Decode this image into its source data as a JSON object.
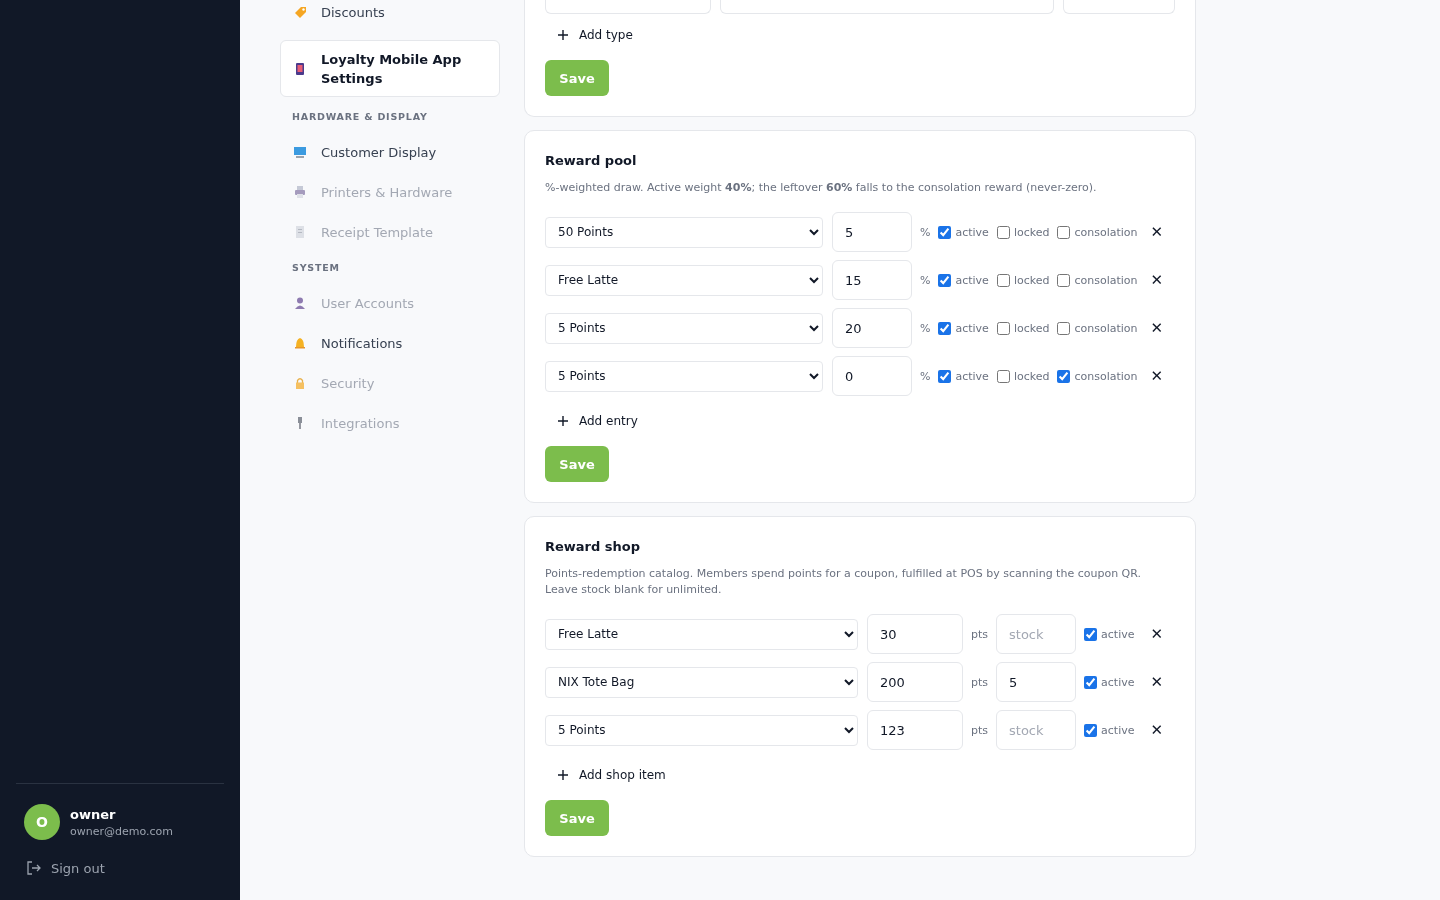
{
  "nav": {
    "items": [
      {
        "label": "Discounts",
        "selected": false,
        "disabled": false
      },
      {
        "label": "Loyalty Mobile App Settings",
        "selected": true,
        "disabled": false
      }
    ],
    "sections": [
      {
        "title": "HARDWARE & DISPLAY",
        "items": [
          {
            "label": "Customer Display",
            "selected": false,
            "disabled": false
          },
          {
            "label": "Printers & Hardware",
            "selected": false,
            "disabled": true
          },
          {
            "label": "Receipt Template",
            "selected": false,
            "disabled": true
          }
        ]
      },
      {
        "title": "SYSTEM",
        "items": [
          {
            "label": "User Accounts",
            "selected": false,
            "disabled": true
          },
          {
            "label": "Notifications",
            "selected": false,
            "disabled": false
          },
          {
            "label": "Security",
            "selected": false,
            "disabled": true
          },
          {
            "label": "Integrations",
            "selected": false,
            "disabled": true
          }
        ]
      }
    ]
  },
  "user": {
    "initial": "O",
    "name": "owner",
    "email": "owner@demo.com",
    "sign_out": "Sign out"
  },
  "types_card": {
    "add_label": "Add type",
    "save": "Save"
  },
  "reward_pool": {
    "title": "Reward pool",
    "description": "%-weighted draw. Active weight **40%**; the leftover **60%** falls to the consolation reward (never-zero).",
    "entries": [
      {
        "reward": "50 Points",
        "weight": "5",
        "unit": "%",
        "active": true,
        "active_label": "active",
        "locked": false,
        "locked_label": "locked",
        "consolation": false,
        "consolation_label": "consolation",
        "remove": "✕"
      },
      {
        "reward": "Free Latte",
        "weight": "15",
        "unit": "%",
        "active": true,
        "active_label": "active",
        "locked": false,
        "locked_label": "locked",
        "consolation": false,
        "consolation_label": "consolation",
        "remove": "✕"
      },
      {
        "reward": "5 Points",
        "weight": "20",
        "unit": "%",
        "active": true,
        "active_label": "active",
        "locked": false,
        "locked_label": "locked",
        "consolation": false,
        "consolation_label": "consolation",
        "remove": "✕"
      },
      {
        "reward": "5 Points",
        "weight": "0",
        "unit": "%",
        "active": true,
        "active_label": "active",
        "locked": false,
        "locked_label": "locked",
        "consolation": true,
        "consolation_label": "consolation",
        "remove": "✕"
      }
    ],
    "add_label": "Add entry",
    "save": "Save"
  },
  "reward_shop": {
    "title": "Reward shop",
    "description": "Points-redemption catalog. Members spend points for a coupon, fulfilled at POS by scanning the coupon QR. Leave stock blank for unlimited.",
    "items": [
      {
        "reward": "Free Latte",
        "points": "30",
        "unit": "pts",
        "stock_placeholder": "stock",
        "active": true,
        "active_label": "active",
        "remove": "✕"
      },
      {
        "reward": "NIX Tote Bag",
        "points": "200",
        "unit": "pts",
        "stock": "5",
        "active": true,
        "active_label": "active",
        "remove": "✕"
      },
      {
        "reward": "5 Points",
        "points": "123",
        "unit": "pts",
        "stock_placeholder": "stock",
        "active": true,
        "active_label": "active",
        "remove": "✕"
      }
    ],
    "add_label": "Add shop item",
    "save": "Save"
  }
}
